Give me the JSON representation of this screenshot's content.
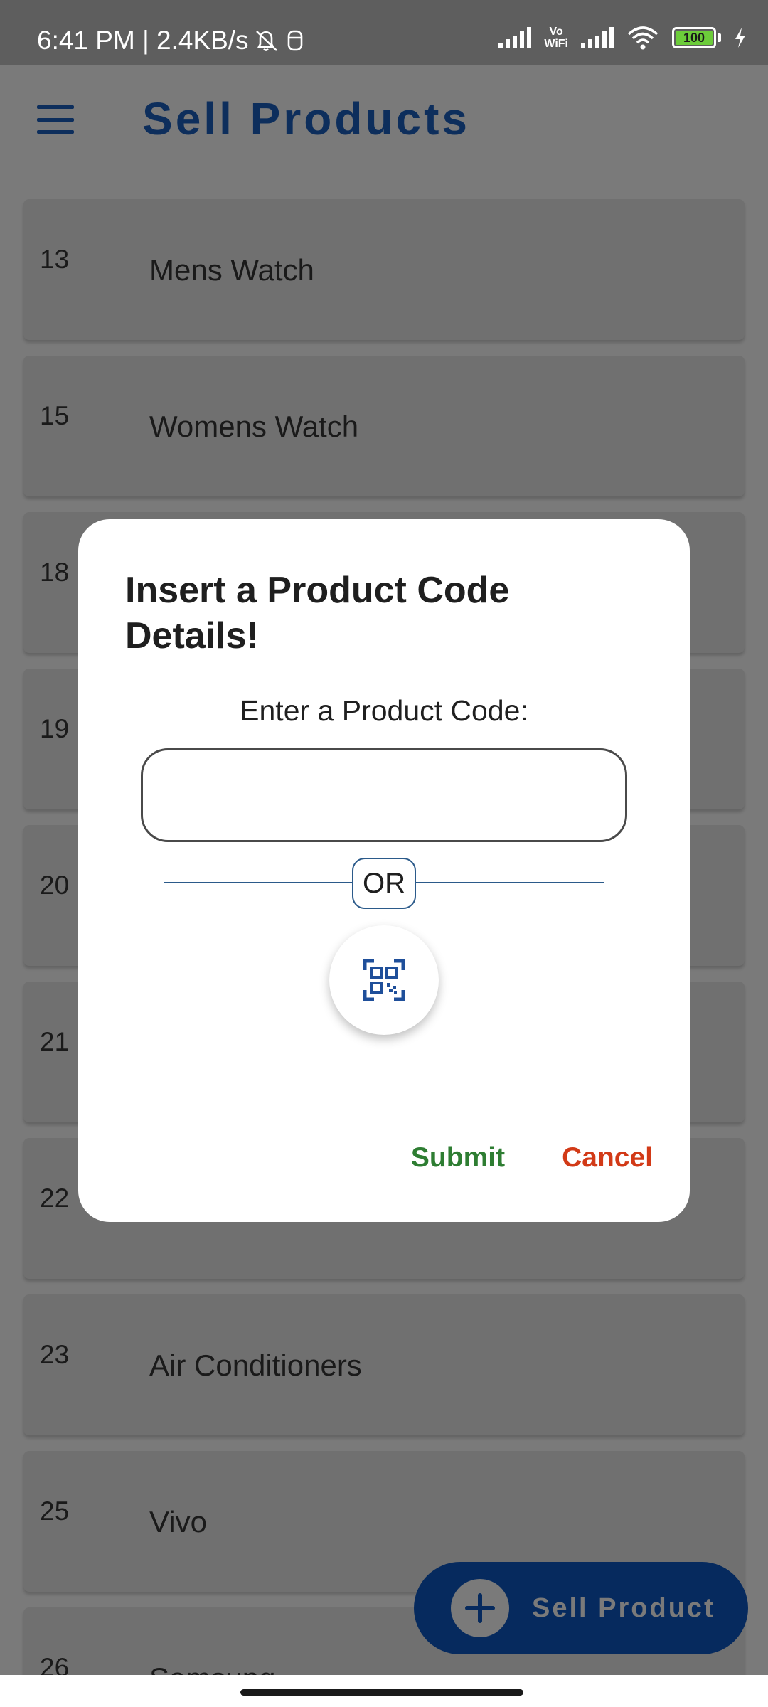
{
  "status_bar": {
    "time_speed": "6:41 PM | 2.4KB/s",
    "vowifi_top": "Vo",
    "vowifi_bottom": "WiFi",
    "battery": "100"
  },
  "app_bar": {
    "title": "Sell Products",
    "menu_icon": "hamburger-menu-icon"
  },
  "products": [
    {
      "id": "13",
      "name": "Mens Watch"
    },
    {
      "id": "15",
      "name": "Womens Watch"
    },
    {
      "id": "18",
      "name": ""
    },
    {
      "id": "19",
      "name": ""
    },
    {
      "id": "20",
      "name": ""
    },
    {
      "id": "21",
      "name": ""
    },
    {
      "id": "22",
      "name": ""
    },
    {
      "id": "23",
      "name": "Air Conditioners"
    },
    {
      "id": "25",
      "name": "Vivo"
    },
    {
      "id": "26",
      "name": "Samsung"
    }
  ],
  "fab": {
    "label": "Sell Product",
    "icon": "plus-circle-icon"
  },
  "dialog": {
    "title": "Insert a Product Code Details!",
    "field_label": "Enter a Product Code:",
    "input_value": "",
    "or_text": "OR",
    "scan_icon": "qr-scan-icon",
    "submit_label": "Submit",
    "cancel_label": "Cancel",
    "colors": {
      "submit": "#2e7d32",
      "cancel": "#d23a17",
      "accent": "#0d2e5c"
    }
  }
}
